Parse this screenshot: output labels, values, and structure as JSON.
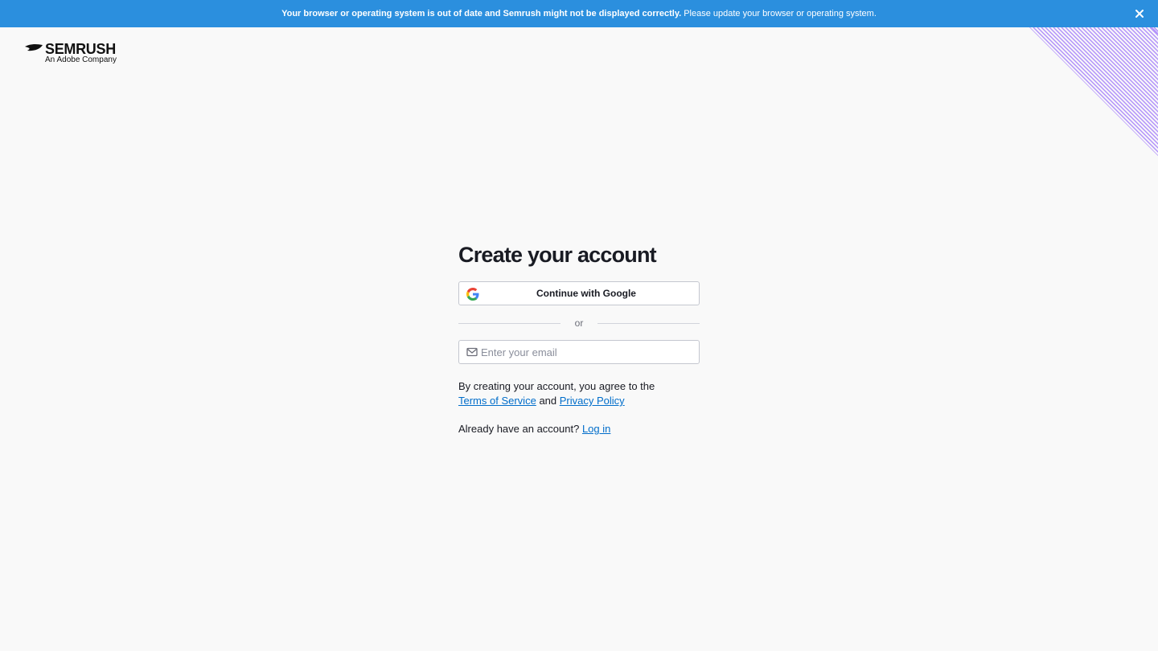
{
  "banner": {
    "bold_text": "Your browser or operating system is out of date and Semrush might not be displayed correctly.",
    "text": "Please update your browser or operating system.",
    "close_icon": "close-icon",
    "color": "#2b8fde"
  },
  "logo": {
    "brand": "SEMRUSH",
    "sub": "An Adobe Company"
  },
  "form": {
    "title": "Create your account",
    "google_button": "Continue with Google",
    "divider": "or",
    "email_placeholder": "Enter your email",
    "legal_prefix": "By creating your account, you agree to the",
    "terms_link": "Terms of Service",
    "legal_and": "and",
    "privacy_link": "Privacy Policy",
    "login_prefix": "Already have an account?",
    "login_link": "Log in"
  },
  "colors": {
    "link": "#006dca",
    "accent_stripes": "#a86cf0"
  }
}
